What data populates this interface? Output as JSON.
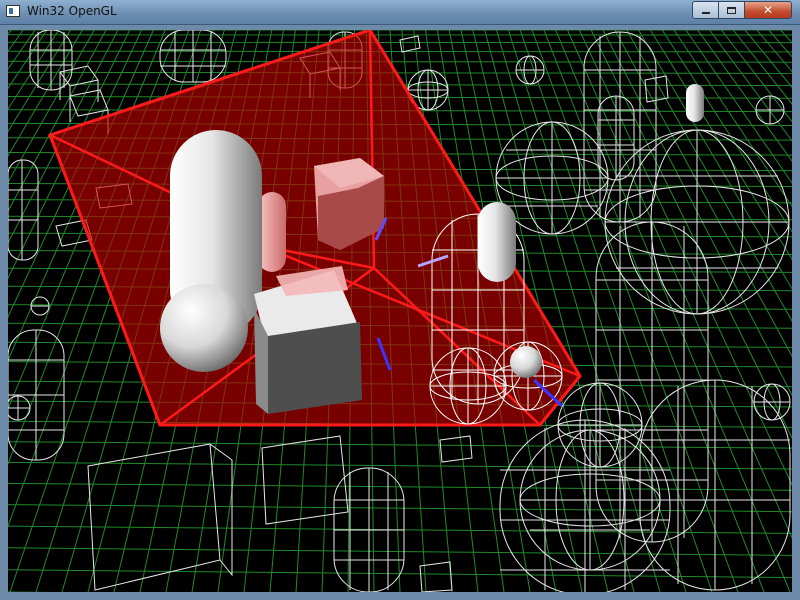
{
  "window": {
    "title": "Win32 OpenGL",
    "minimize_label": "minimize",
    "maximize_label": "maximize",
    "close_label": "close"
  },
  "scene": {
    "description_colors": {
      "grid": "#1f8a2a",
      "wire": "#ffffff",
      "selection_fill": "#b40000",
      "selection_edge": "#ff1a1a"
    }
  }
}
